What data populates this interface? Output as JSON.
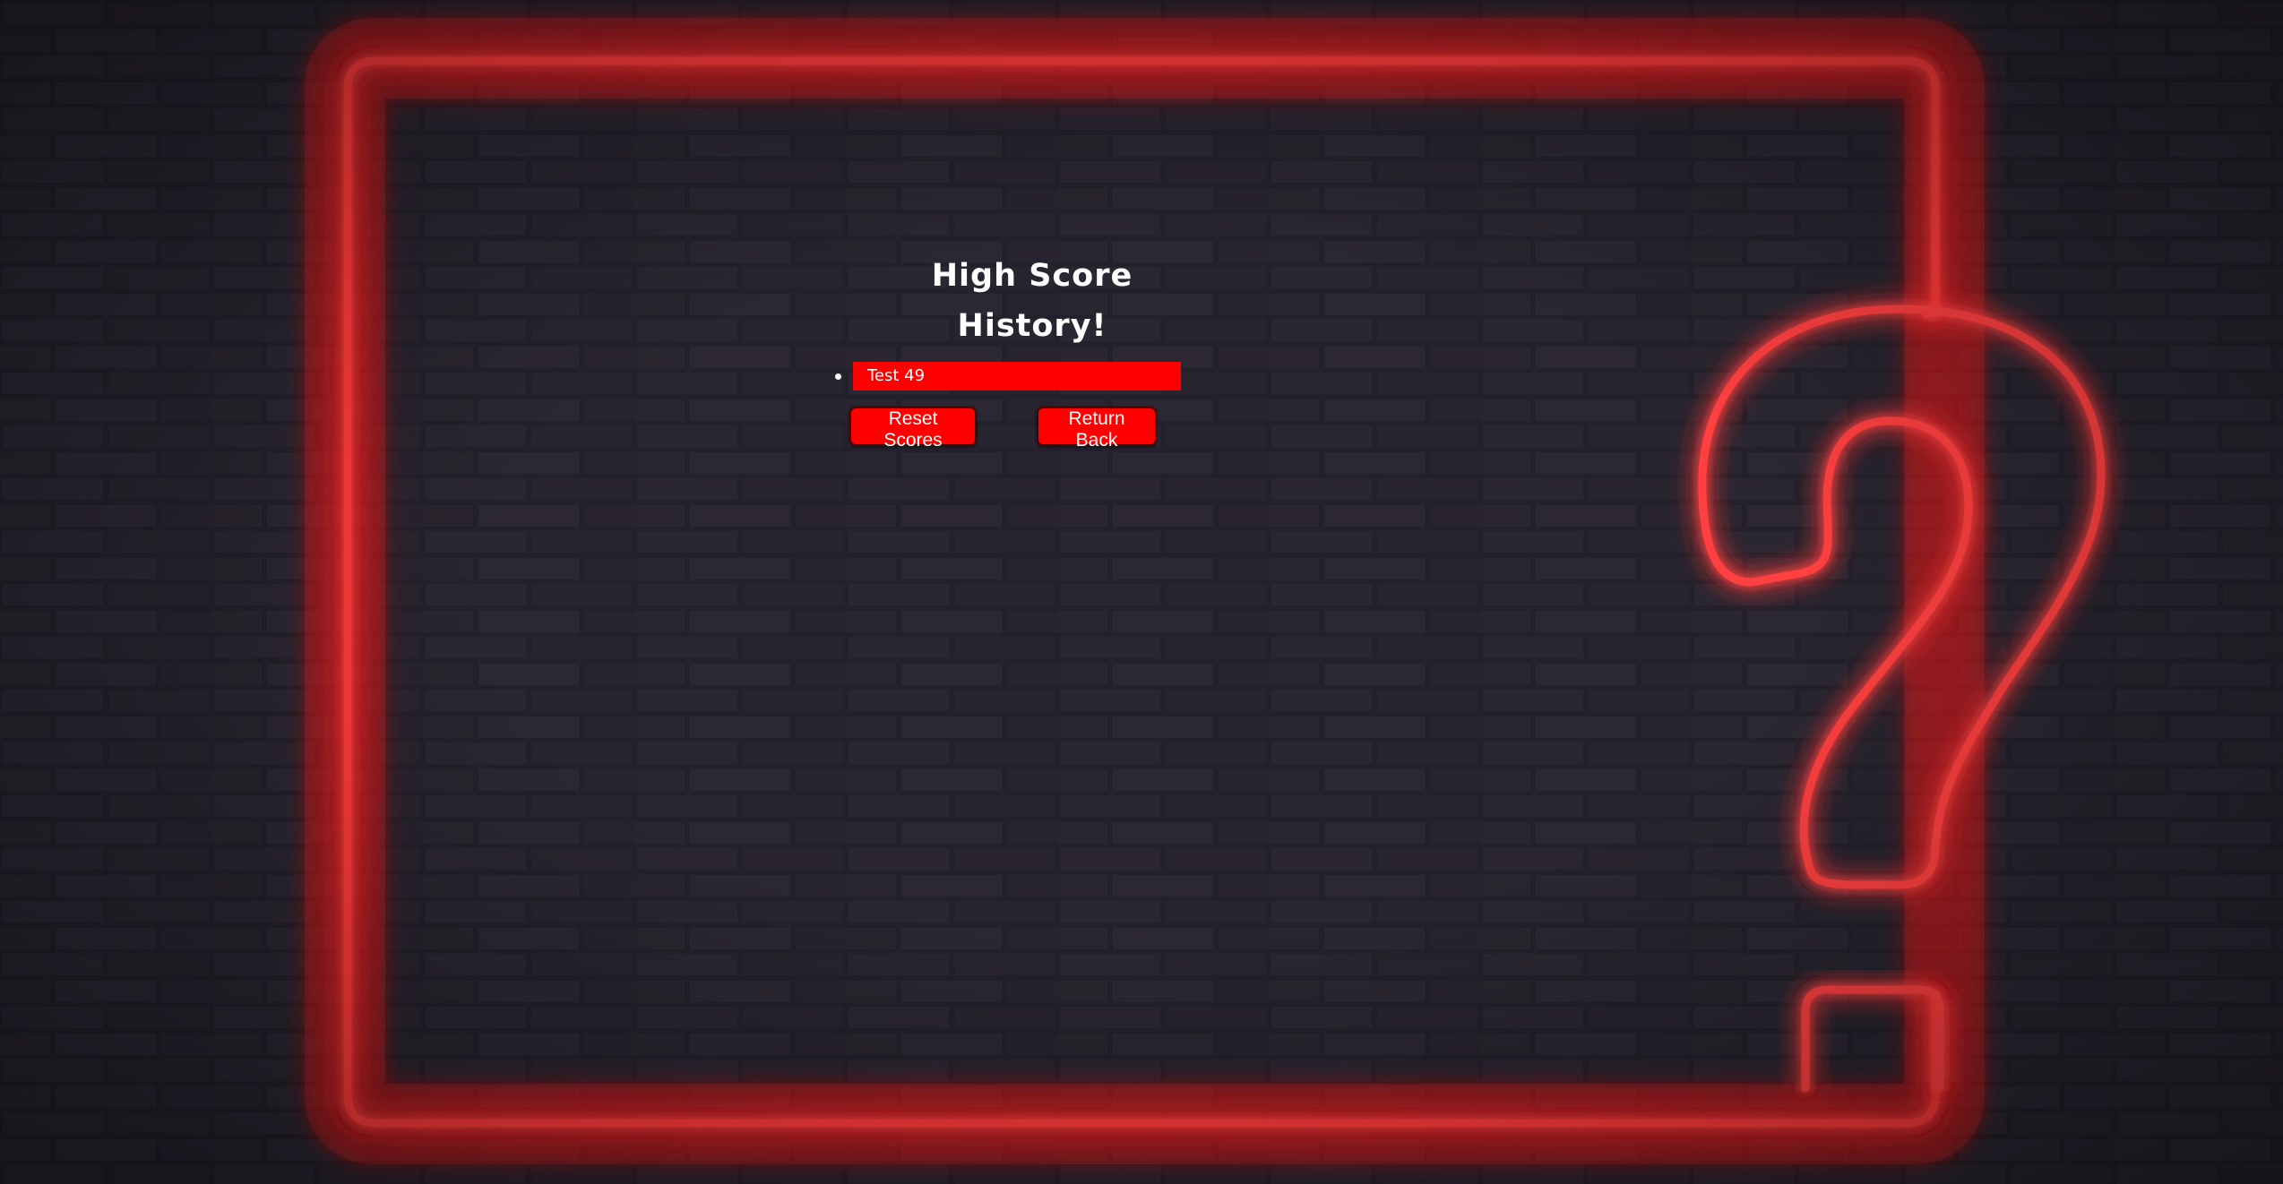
{
  "page": {
    "title": "High Score History!"
  },
  "scores": [
    {
      "entry": "Test 49"
    }
  ],
  "buttons": {
    "reset_label": "Reset Scores",
    "return_label": "Return Back"
  },
  "colors": {
    "neon": "#ff2a2a",
    "accent": "#ff0000",
    "wall": "#211f29"
  },
  "decor": {
    "background": "neon-question-mark-on-brick-wall"
  }
}
